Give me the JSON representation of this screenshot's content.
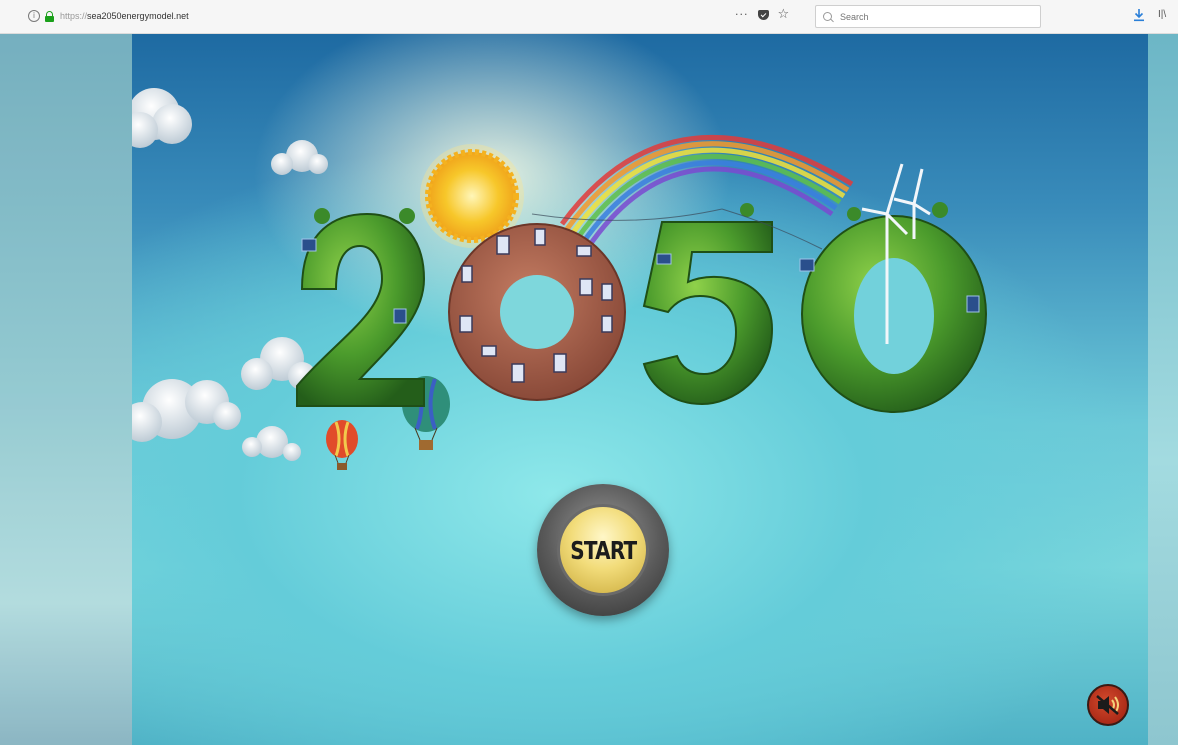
{
  "browser": {
    "url_scheme": "https://",
    "url_host": "sea2050energymodel.net",
    "search_placeholder": "Search",
    "menu_dots": "···"
  },
  "logo": {
    "text": "2050",
    "colors": {
      "foliage": "#3f8f25",
      "brick": "#a7624e",
      "sun": "#f7c72a"
    }
  },
  "start": {
    "label": "START"
  },
  "sound": {
    "icon": "speaker-muted-icon"
  },
  "icons": [
    "info-icon",
    "lock-icon",
    "page-actions-icon",
    "pocket-icon",
    "bookmark-star-icon",
    "search-icon",
    "download-icon",
    "library-icon",
    "sun-icon",
    "rainbow",
    "cloud",
    "hot-air-balloon",
    "wind-turbine",
    "solar-panel",
    "speaker-muted-icon"
  ]
}
